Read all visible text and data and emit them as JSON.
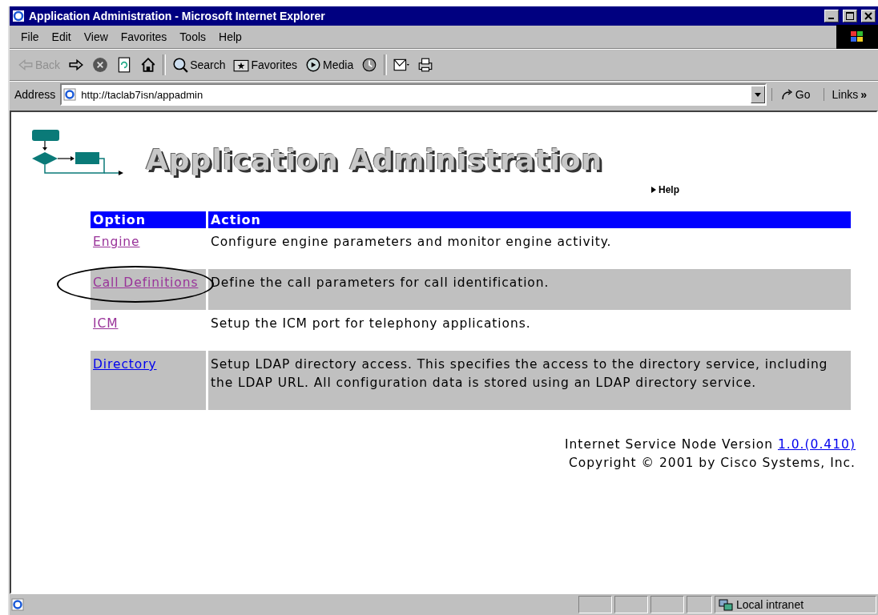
{
  "window": {
    "title": "Application Administration - Microsoft Internet Explorer"
  },
  "menu": [
    "File",
    "Edit",
    "View",
    "Favorites",
    "Tools",
    "Help"
  ],
  "toolbar": [
    {
      "kind": "back",
      "label": "Back",
      "disabled": true
    },
    {
      "kind": "forward",
      "disabled": false
    },
    {
      "kind": "stop",
      "disabled": false
    },
    {
      "kind": "refresh",
      "disabled": false
    },
    {
      "kind": "home",
      "disabled": false
    },
    {
      "kind": "search",
      "label": "Search",
      "disabled": false
    },
    {
      "kind": "favorites",
      "label": "Favorites",
      "disabled": false
    },
    {
      "kind": "media",
      "label": "Media",
      "disabled": false
    },
    {
      "kind": "history",
      "disabled": false
    },
    {
      "kind": "mail",
      "disabled": false
    },
    {
      "kind": "print",
      "disabled": false
    }
  ],
  "address": {
    "label": "Address",
    "value": "http://taclab7isn/appadmin",
    "go": "Go",
    "links": "Links",
    "more": "»"
  },
  "page": {
    "heading": "Application Administration",
    "help": "Help",
    "table": {
      "columns": [
        "Option",
        "Action"
      ],
      "rows": [
        {
          "option": "Engine",
          "visited": true,
          "circled": false,
          "action": "Configure engine parameters and monitor engine activity."
        },
        {
          "option": "Call Definitions",
          "visited": true,
          "circled": true,
          "action": "Define the call parameters for call identification."
        },
        {
          "option": "ICM",
          "visited": true,
          "circled": false,
          "action": "Setup the ICM port for telephony applications."
        },
        {
          "option": "Directory",
          "visited": false,
          "circled": false,
          "action": "Setup LDAP directory access. This specifies the access to the directory service, including the LDAP URL. All configuration data is stored using an LDAP directory service."
        }
      ]
    },
    "footer": {
      "version_label": "Internet Service Node Version",
      "version": "1.0.(0.410)",
      "copyright": "Copyright © 2001 by Cisco Systems, Inc."
    }
  },
  "status_bar": {
    "zone": "Local intranet"
  }
}
